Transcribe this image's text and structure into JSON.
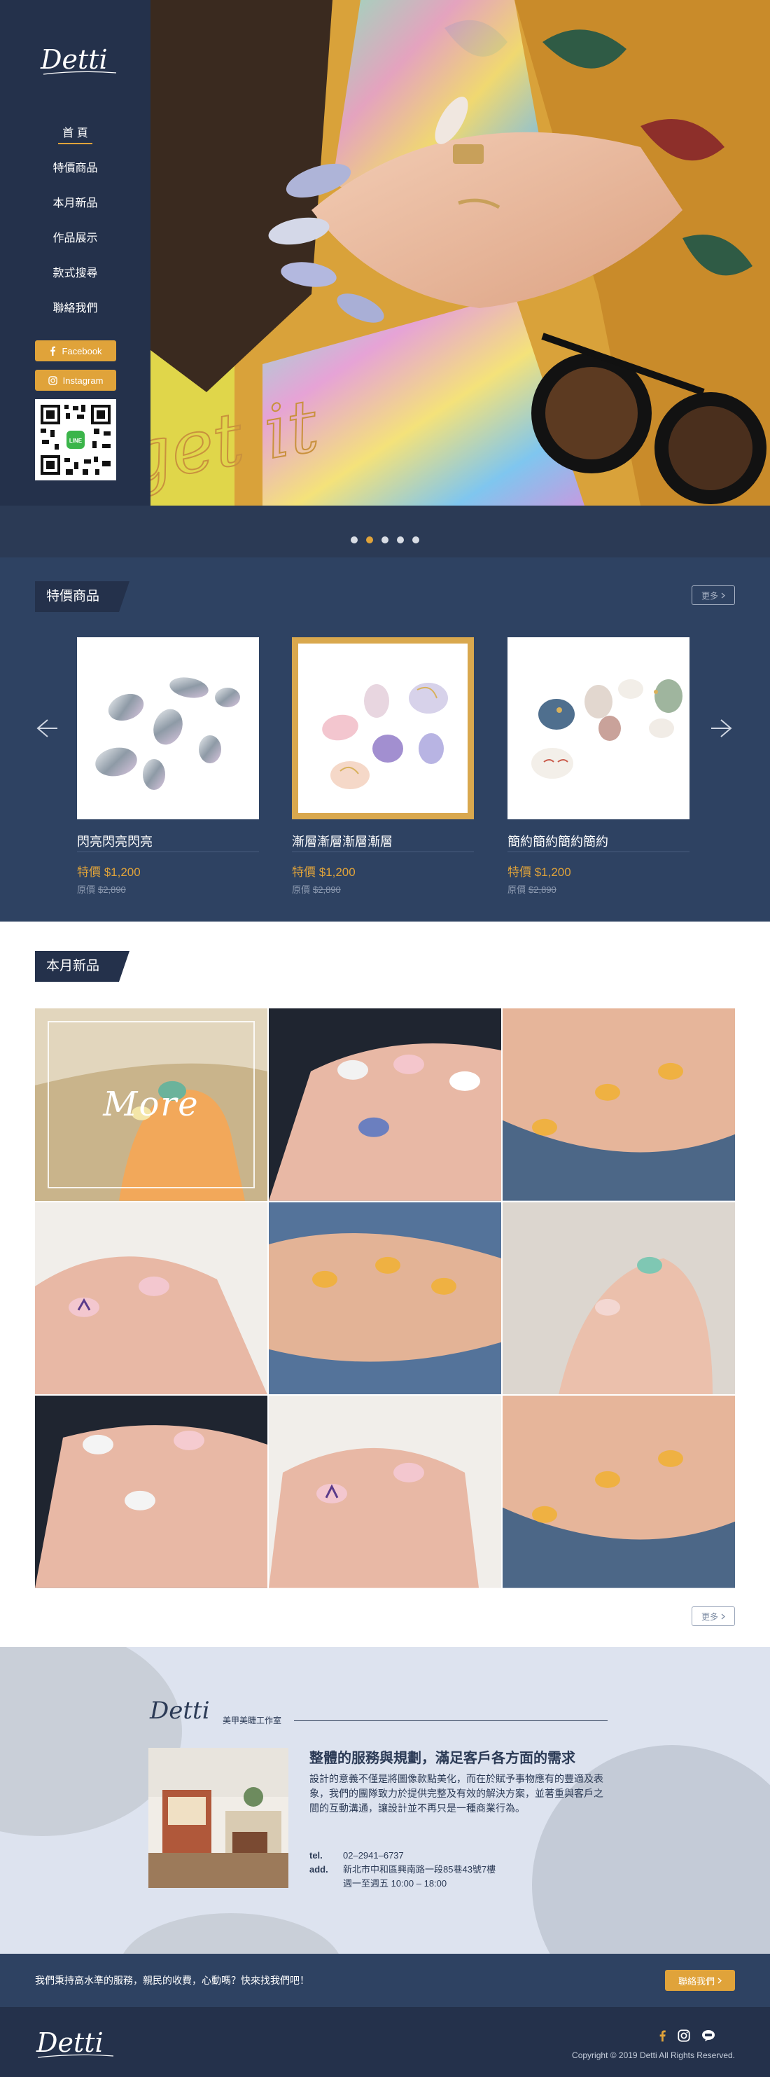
{
  "brand": {
    "logo_text": "Detti",
    "hero_script": "get it",
    "studio_label": "美甲美睫工作室"
  },
  "nav": {
    "items": [
      {
        "label": "首 頁",
        "active": true
      },
      {
        "label": "特價商品",
        "active": false
      },
      {
        "label": "本月新品",
        "active": false
      },
      {
        "label": "作品展示",
        "active": false
      },
      {
        "label": "款式搜尋",
        "active": false
      },
      {
        "label": "聯絡我們",
        "active": false
      }
    ]
  },
  "social": {
    "facebook_label": "Facebook",
    "instagram_label": "Instagram",
    "qr_badge": "LINE"
  },
  "slider": {
    "dots_count": 5,
    "active_dot": 2
  },
  "specials": {
    "title": "特價商品",
    "more_label": "更多",
    "products": [
      {
        "name": "閃亮閃亮閃亮",
        "price": "特價 $1,200",
        "orig_label": "原價",
        "orig_price": "$2,890",
        "highlight": false
      },
      {
        "name": "漸層漸層漸層漸層",
        "price": "特價 $1,200",
        "orig_label": "原價",
        "orig_price": "$2,890",
        "highlight": true
      },
      {
        "name": "簡約簡約簡約簡約",
        "price": "特價 $1,200",
        "orig_label": "原價",
        "orig_price": "$2,890",
        "highlight": false
      }
    ]
  },
  "new_items": {
    "title": "本月新品",
    "more_overlay": "More",
    "more_label": "更多"
  },
  "about": {
    "title": "整體的服務與規劃，滿足客戶各方面的需求",
    "description": "設計的意義不僅是將圖像款點美化，而在於賦予事物應有的豐適及表象，我們的團隊致力於提供完整及有效的解決方案，並著重與客戶之間的互動溝通，讓設計並不再只是一種商業行為。",
    "tel_label": "tel.",
    "tel": "02–2941–6737",
    "add_label": "add.",
    "address": "新北市中和區興南路一段85巷43號7樓",
    "hours": "週一至週五 10:00 – 18:00"
  },
  "cta": {
    "text": "我們秉持高水準的服務，親民的收費，心動嗎？快來找我們吧！",
    "button_label": "聯絡我們"
  },
  "footer": {
    "copyright": "Copyright © 2019 Detti All Rights Reserved."
  },
  "colors": {
    "navy": "#24314b",
    "navy_mid": "#2e4262",
    "gold": "#e0a33a",
    "about_bg": "#dde3ef"
  }
}
